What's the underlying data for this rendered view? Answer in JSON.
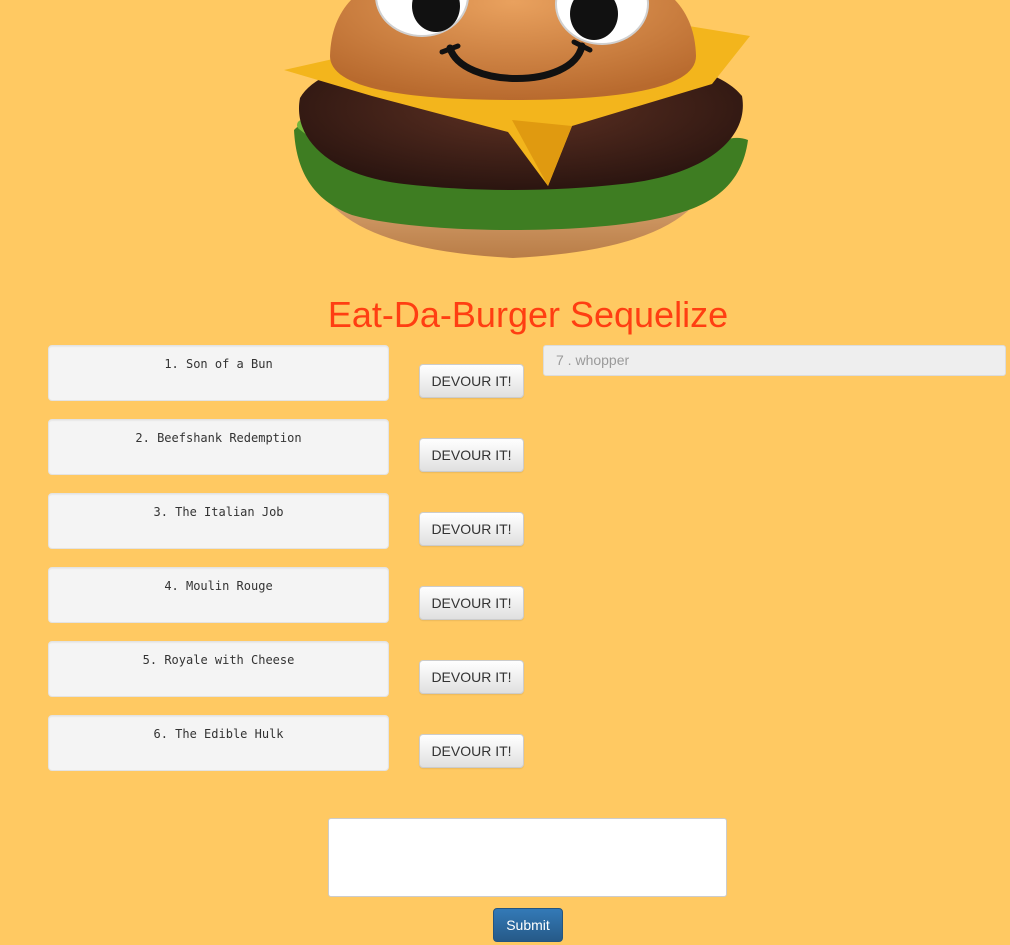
{
  "header": {
    "logo_icon": "smiling-cheeseburger-logo",
    "title": "Eat-Da-Burger Sequelize"
  },
  "burgers": [
    {
      "label": "1. Son of a Bun",
      "button": "DEVOUR IT!"
    },
    {
      "label": "2. Beefshank Redemption",
      "button": "DEVOUR IT!"
    },
    {
      "label": "3. The Italian Job",
      "button": "DEVOUR IT!"
    },
    {
      "label": "4. Moulin Rouge",
      "button": "DEVOUR IT!"
    },
    {
      "label": "5. Royale with Cheese",
      "button": "DEVOUR IT!"
    },
    {
      "label": "6. The Edible Hulk",
      "button": "DEVOUR IT!"
    }
  ],
  "devoured": [
    {
      "label": "7 . whopper"
    }
  ],
  "form": {
    "input_value": "",
    "submit_label": "Submit"
  },
  "colors": {
    "background": "#ffc962",
    "title": "#ff3e12",
    "submit": "#337ab7"
  }
}
